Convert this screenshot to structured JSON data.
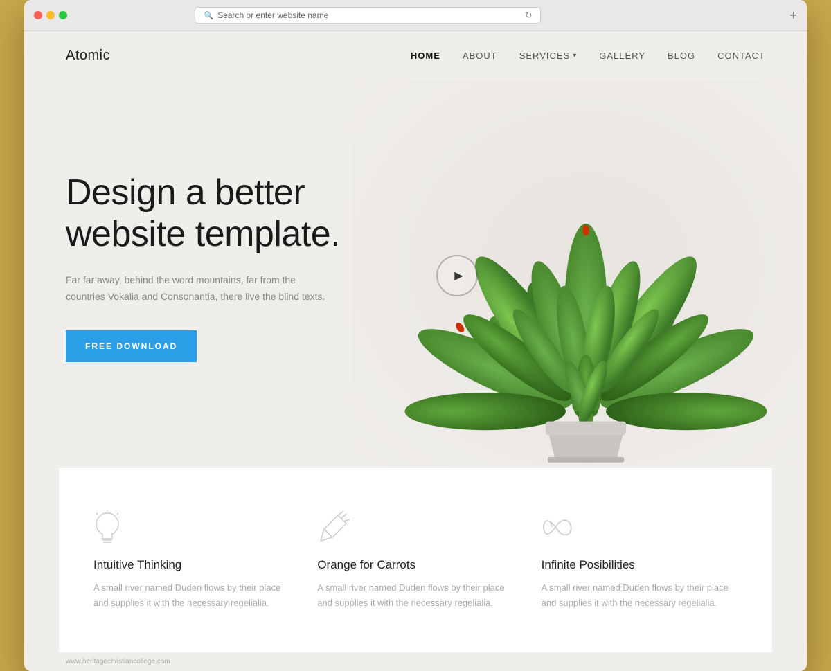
{
  "browser": {
    "address_placeholder": "Search or enter website name",
    "new_tab_icon": "+"
  },
  "site": {
    "logo": "Atomic",
    "nav": {
      "home": "HOME",
      "about": "ABOUT",
      "services": "SERVICES",
      "gallery": "GALLERY",
      "blog": "BLOG",
      "contact": "CONTACT"
    }
  },
  "hero": {
    "title": "Design a better website template.",
    "description": "Far far away, behind the word mountains, far from the countries Vokalia and Consonantia, there live the blind texts.",
    "cta_label": "FREE DOWNLOAD"
  },
  "features": [
    {
      "icon": "lightbulb-icon",
      "title": "Intuitive Thinking",
      "description": "A small river named Duden flows by their place and supplies it with the necessary regelialia."
    },
    {
      "icon": "carrot-icon",
      "title": "Orange for Carrots",
      "description": "A small river named Duden flows by their place and supplies it with the necessary regelialia."
    },
    {
      "icon": "infinity-icon",
      "title": "Infinite Posibilities",
      "description": "A small river named Duden flows by their place and supplies it with the necessary regelialia."
    }
  ],
  "watermark": {
    "text": "www.heritagechristiancollege.com"
  },
  "colors": {
    "accent_blue": "#2b9fe8",
    "bg_light": "#f0eeeb",
    "text_dark": "#1a1a1a",
    "text_muted": "#888888",
    "nav_active": "#111111"
  }
}
